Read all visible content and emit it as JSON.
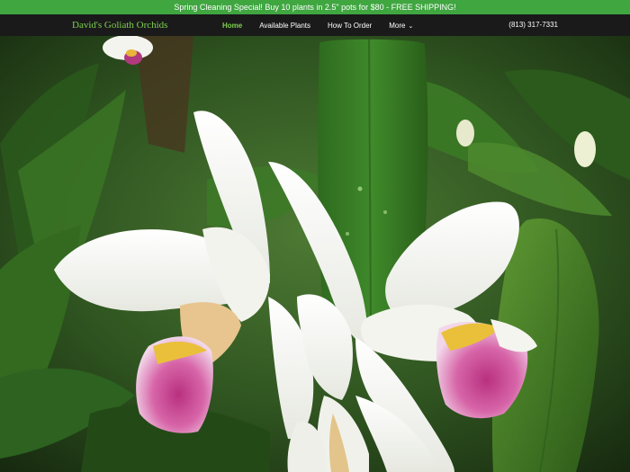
{
  "promo": {
    "text": "Spring Cleaning Special! Buy 10 plants in 2.5\" pots for $80 - FREE SHIPPING!"
  },
  "nav": {
    "brand": "David's Goliath Orchids",
    "links": [
      {
        "label": "Home",
        "active": true
      },
      {
        "label": "Available Plants",
        "active": false
      },
      {
        "label": "How To Order",
        "active": false
      },
      {
        "label": "More",
        "active": false
      }
    ],
    "more_icon": "chevron-down-icon",
    "phone": "(813) 317-7331"
  },
  "hero": {
    "subject": "orchid-photo"
  },
  "colors": {
    "promo_bg": "#3fa640",
    "nav_bg": "#1a1a1a",
    "brand_green": "#7ed04f",
    "white": "#ffffff"
  }
}
